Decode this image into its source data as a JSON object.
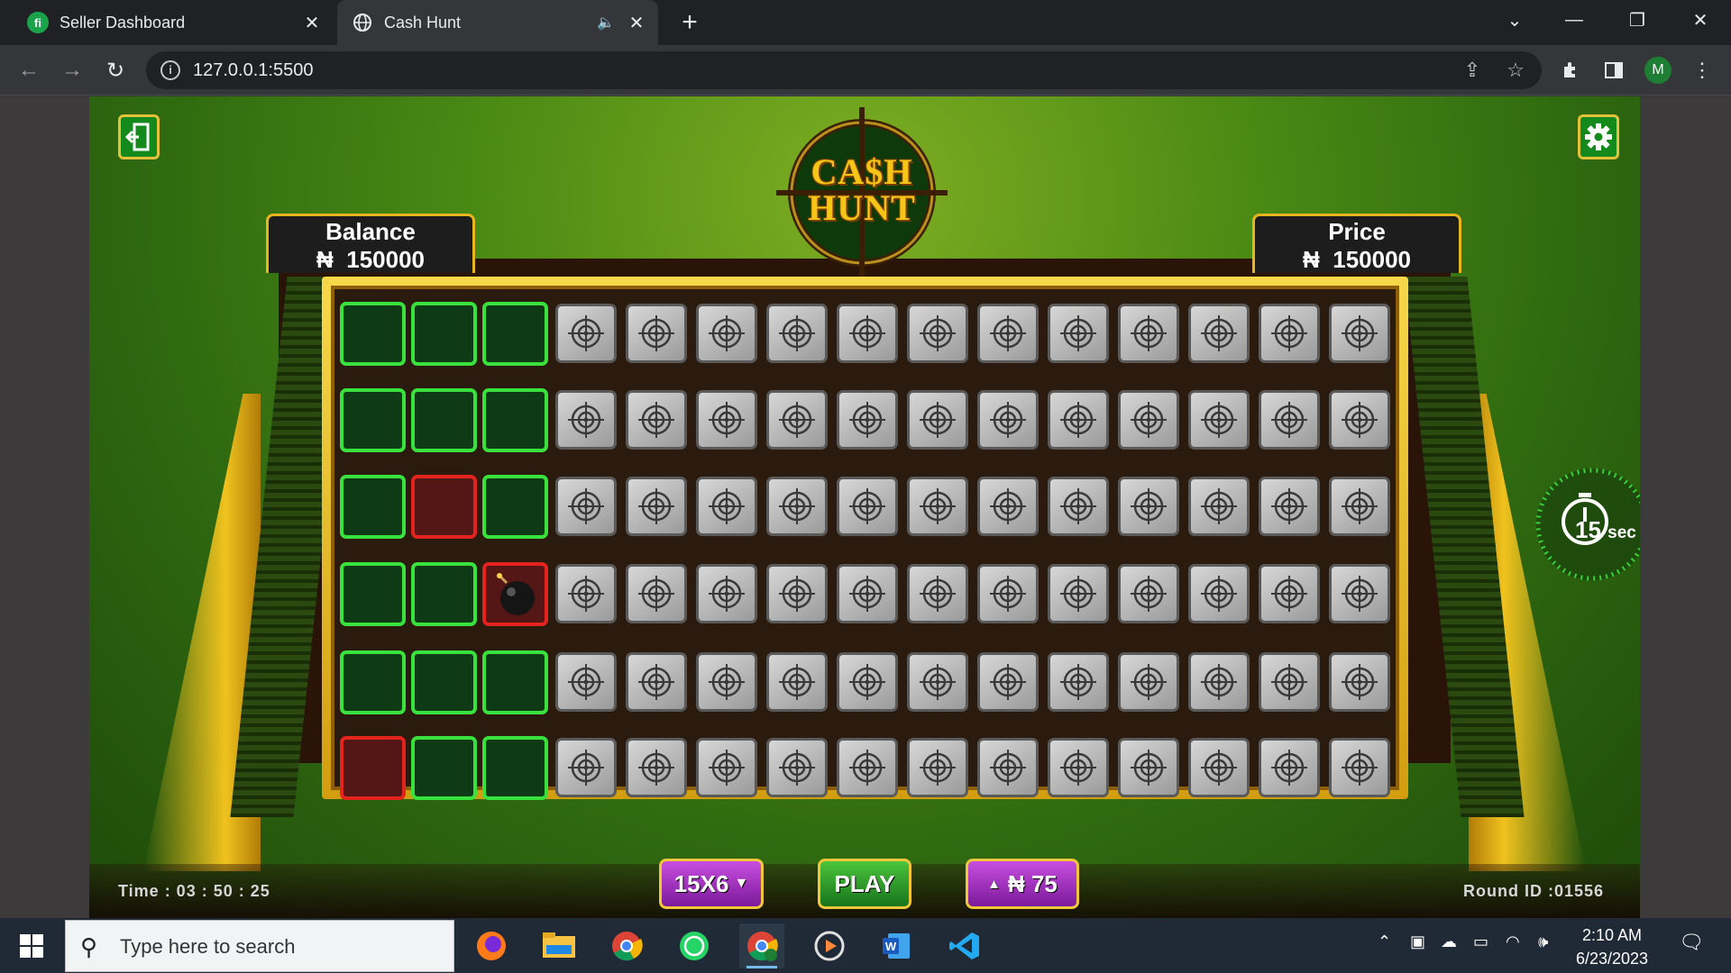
{
  "browser": {
    "tabs": [
      {
        "title": "Seller Dashboard",
        "favicon": "fi",
        "active": false
      },
      {
        "title": "Cash Hunt",
        "active": true
      }
    ],
    "url": "127.0.0.1:5500",
    "profile_initial": "M"
  },
  "game": {
    "logo_line1": "CA$H",
    "logo_line2": "HUNT",
    "balance_label": "Balance",
    "balance_value": "150000",
    "price_label": "Price",
    "price_value": "150000",
    "currency_symbol": "₦",
    "timer_value": "15",
    "timer_unit": "sec",
    "time_label": "Time  :  03 : 50 : 25",
    "round_label": "Round ID :01556",
    "size_button": "15X6",
    "play_button": "PLAY",
    "bet_button": "75",
    "grid_columns": 15,
    "grid_rows": 6,
    "grid": [
      [
        "green",
        "green",
        "green",
        "target",
        "target",
        "target",
        "target",
        "target",
        "target",
        "target",
        "target",
        "target",
        "target",
        "target",
        "target"
      ],
      [
        "green",
        "green",
        "green",
        "target",
        "target",
        "target",
        "target",
        "target",
        "target",
        "target",
        "target",
        "target",
        "target",
        "target",
        "target"
      ],
      [
        "green",
        "red",
        "green",
        "target",
        "target",
        "target",
        "target",
        "target",
        "target",
        "target",
        "target",
        "target",
        "target",
        "target",
        "target"
      ],
      [
        "green",
        "green",
        "bomb",
        "target",
        "target",
        "target",
        "target",
        "target",
        "target",
        "target",
        "target",
        "target",
        "target",
        "target",
        "target"
      ],
      [
        "green",
        "green",
        "green",
        "target",
        "target",
        "target",
        "target",
        "target",
        "target",
        "target",
        "target",
        "target",
        "target",
        "target",
        "target"
      ],
      [
        "red",
        "green",
        "green",
        "target",
        "target",
        "target",
        "target",
        "target",
        "target",
        "target",
        "target",
        "target",
        "target",
        "target",
        "target"
      ]
    ]
  },
  "taskbar": {
    "search_placeholder": "Type here to search",
    "time": "2:10 AM",
    "date": "6/23/2023",
    "apps": [
      "firefox-icon",
      "file-explorer-icon",
      "chrome-icon",
      "whatsapp-icon",
      "chrome-profile-icon",
      "media-player-icon",
      "word-icon",
      "vscode-icon"
    ]
  },
  "colors": {
    "green_cell": "#39e13c",
    "red_cell": "#e3231d",
    "gold": "#f0c21e"
  }
}
